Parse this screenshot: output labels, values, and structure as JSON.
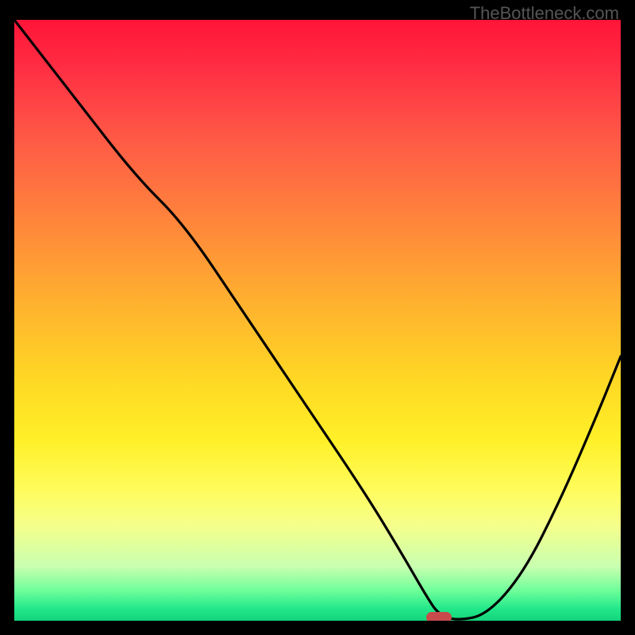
{
  "watermark": "TheBottleneck.com",
  "chart_data": {
    "type": "line",
    "title": "",
    "xlabel": "",
    "ylabel": "",
    "xlim": [
      0,
      100
    ],
    "ylim": [
      0,
      100
    ],
    "grid": false,
    "series": [
      {
        "name": "curve",
        "x": [
          0,
          10,
          20,
          28,
          38,
          48,
          58,
          64,
          68,
          70,
          73,
          78,
          84,
          90,
          96,
          100
        ],
        "y": [
          100,
          87,
          74,
          66,
          51,
          36,
          21,
          11,
          4,
          1,
          0,
          1,
          8,
          20,
          34,
          44
        ]
      }
    ],
    "marker": {
      "x": 70,
      "y": 0.5,
      "shape": "pill",
      "color": "#c94a4a"
    },
    "gradient_stops": [
      {
        "pos": 0,
        "color": "#ff1438"
      },
      {
        "pos": 50,
        "color": "#ffd824"
      },
      {
        "pos": 100,
        "color": "#14d37a"
      }
    ]
  }
}
